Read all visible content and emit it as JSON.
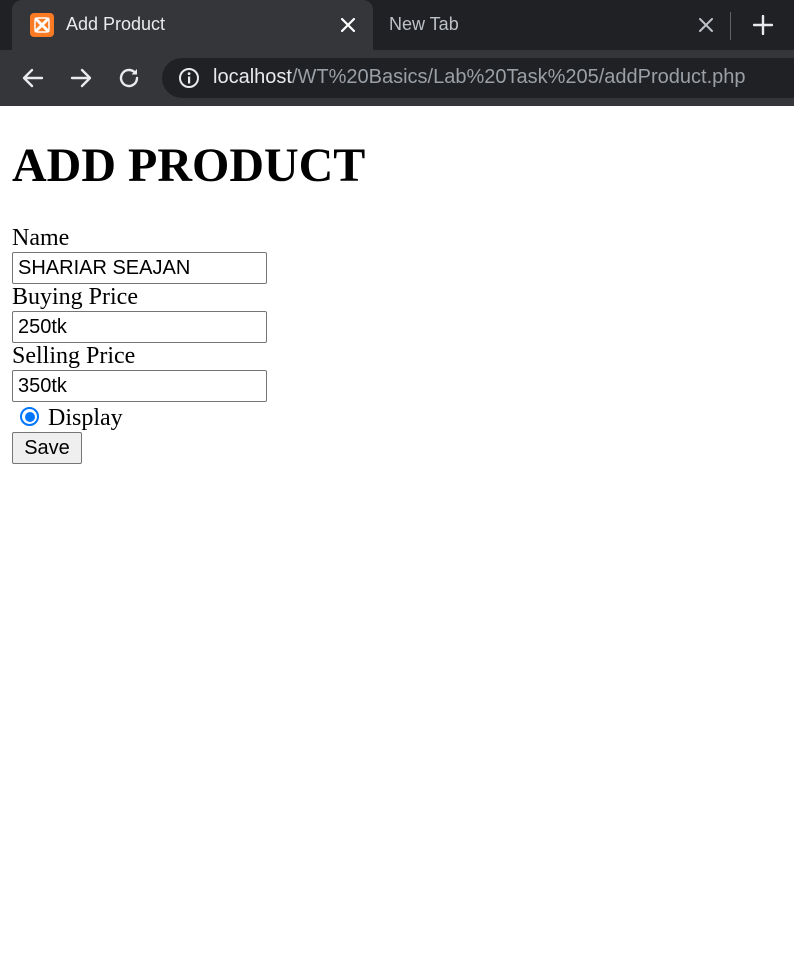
{
  "browser": {
    "tabs": [
      {
        "title": "Add Product",
        "favicon": "xampp-icon",
        "active": true
      },
      {
        "title": "New Tab",
        "active": false
      }
    ],
    "url": {
      "host": "localhost",
      "path": "/WT%20Basics/Lab%20Task%205/addProduct.php"
    }
  },
  "form": {
    "title": "ADD PRODUCT",
    "name_label": "Name",
    "name_value": "SHARIAR SEAJAN",
    "buying_price_label": "Buying Price",
    "buying_price_value": "250tk",
    "selling_price_label": "Selling Price",
    "selling_price_value": "350tk",
    "display_label": "Display",
    "display_checked": true,
    "save_label": "Save"
  },
  "colors": {
    "tabstrip_bg": "#202124",
    "toolbar_bg": "#35363a",
    "radio_accent": "#0075ff",
    "favicon_bg": "#fb7a24"
  }
}
